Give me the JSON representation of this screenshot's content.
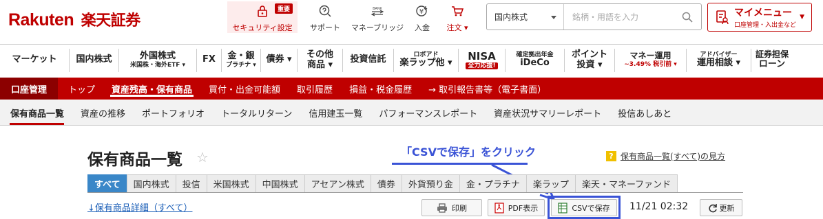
{
  "header": {
    "logo_en": "Rakuten",
    "logo_jp": "楽天証券",
    "util": [
      {
        "label": "セキュリティ設定",
        "icon": "lock-icon",
        "badge": "重要"
      },
      {
        "label": "サポート",
        "icon": "support-icon"
      },
      {
        "label": "マネーブリッジ",
        "icon": "bank-icon"
      },
      {
        "label": "入金",
        "icon": "yen-icon"
      },
      {
        "label": "注文 ▾",
        "icon": "cart-icon"
      }
    ],
    "search": {
      "category": "国内株式",
      "placeholder": "銘柄・用語を入力"
    },
    "mymenu": {
      "title": "マイメニュー",
      "sub": "口座管理・入出金など"
    }
  },
  "global_nav": [
    {
      "l1": "マーケット"
    },
    {
      "l1": "国内株式"
    },
    {
      "l1": "外国株式",
      "l2": "米国株・海外ETF ▾"
    },
    {
      "l1": "FX"
    },
    {
      "l1": "金・銀",
      "l2": "プラチナ ▾"
    },
    {
      "l1": "債券 ▾"
    },
    {
      "l1": "その他",
      "l2": "商品 ▾"
    },
    {
      "l1": "投資信託"
    },
    {
      "l1": "ロボアド",
      "l2": "楽ラップ他 ▾"
    },
    {
      "l1": "NISA",
      "l2": "全力応援!"
    },
    {
      "l1": "確定拠出年金",
      "l2": "iDeCo"
    },
    {
      "l1": "ポイント",
      "l2": "投資 ▾"
    },
    {
      "l1": "マネー運用",
      "l2": "~3.49% 税引前 ▾"
    },
    {
      "l1": "アドバイザー",
      "l2": "運用相談 ▾"
    },
    {
      "l1": "証券担保",
      "l2": "ローン"
    }
  ],
  "account_bar": {
    "label": "口座管理",
    "tabs": [
      "トップ",
      "資産残高・保有商品",
      "買付・出金可能額",
      "取引履歴",
      "損益・税金履歴",
      "→ 取引報告書等（電子書面）"
    ]
  },
  "sub_nav": [
    "保有商品一覧",
    "資産の推移",
    "ポートフォリオ",
    "トータルリターン",
    "信用建玉一覧",
    "パフォーマンスレポート",
    "資産状況サマリーレポート",
    "投信あしあと"
  ],
  "page": {
    "title": "保有商品一覧",
    "annotation": "「CSVで保存」をクリック",
    "help_link": "保有商品一覧(すべて)の見方",
    "tabs": [
      "すべて",
      "国内株式",
      "投信",
      "米国株式",
      "中国株式",
      "アセアン株式",
      "債券",
      "外貨預り金",
      "金・プラチナ",
      "楽ラップ",
      "楽天・マネーファンド"
    ],
    "detail_link": "↓保有商品詳細（すべて）",
    "buttons": {
      "print": "印刷",
      "pdf": "PDF表示",
      "csv": "CSVで保存",
      "refresh": "更新"
    },
    "timestamp": "11/21 02:32"
  },
  "colors": {
    "brand": "#bf0000",
    "annotation": "#3a53d6",
    "tab_active": "#3a87c8"
  }
}
